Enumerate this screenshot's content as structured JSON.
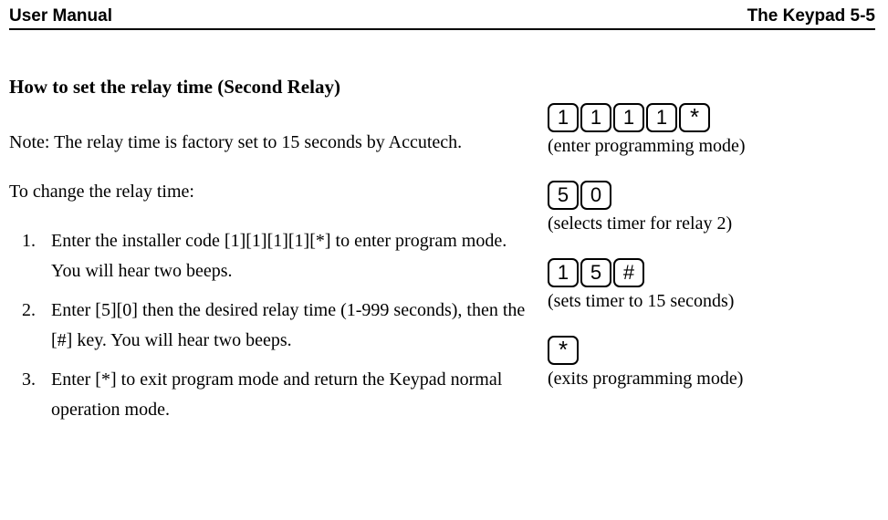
{
  "header": {
    "left": "User Manual",
    "right": "The Keypad 5-5"
  },
  "section_title": "How to set the relay time (Second Relay)",
  "note": "Note: The relay time is factory set to 15 seconds by Accutech.",
  "lead": "To change the relay time:",
  "steps": [
    "Enter the installer code [1][1][1][1][*] to enter program mode. You will hear two beeps.",
    "Enter [5][0] then the desired relay time (1-999 seconds), then the [#] key. You will hear two beeps.",
    "Enter [*] to exit program mode and return the Keypad normal operation mode."
  ],
  "sequences": [
    {
      "keys": [
        "1",
        "1",
        "1",
        "1",
        "*"
      ],
      "caption": "(enter programming mode)"
    },
    {
      "keys": [
        "5",
        "0"
      ],
      "caption": "(selects timer for relay 2)"
    },
    {
      "keys": [
        "1",
        "5",
        "#"
      ],
      "caption": "(sets timer to 15 seconds)"
    },
    {
      "keys": [
        "*"
      ],
      "caption": "(exits programming mode)"
    }
  ]
}
